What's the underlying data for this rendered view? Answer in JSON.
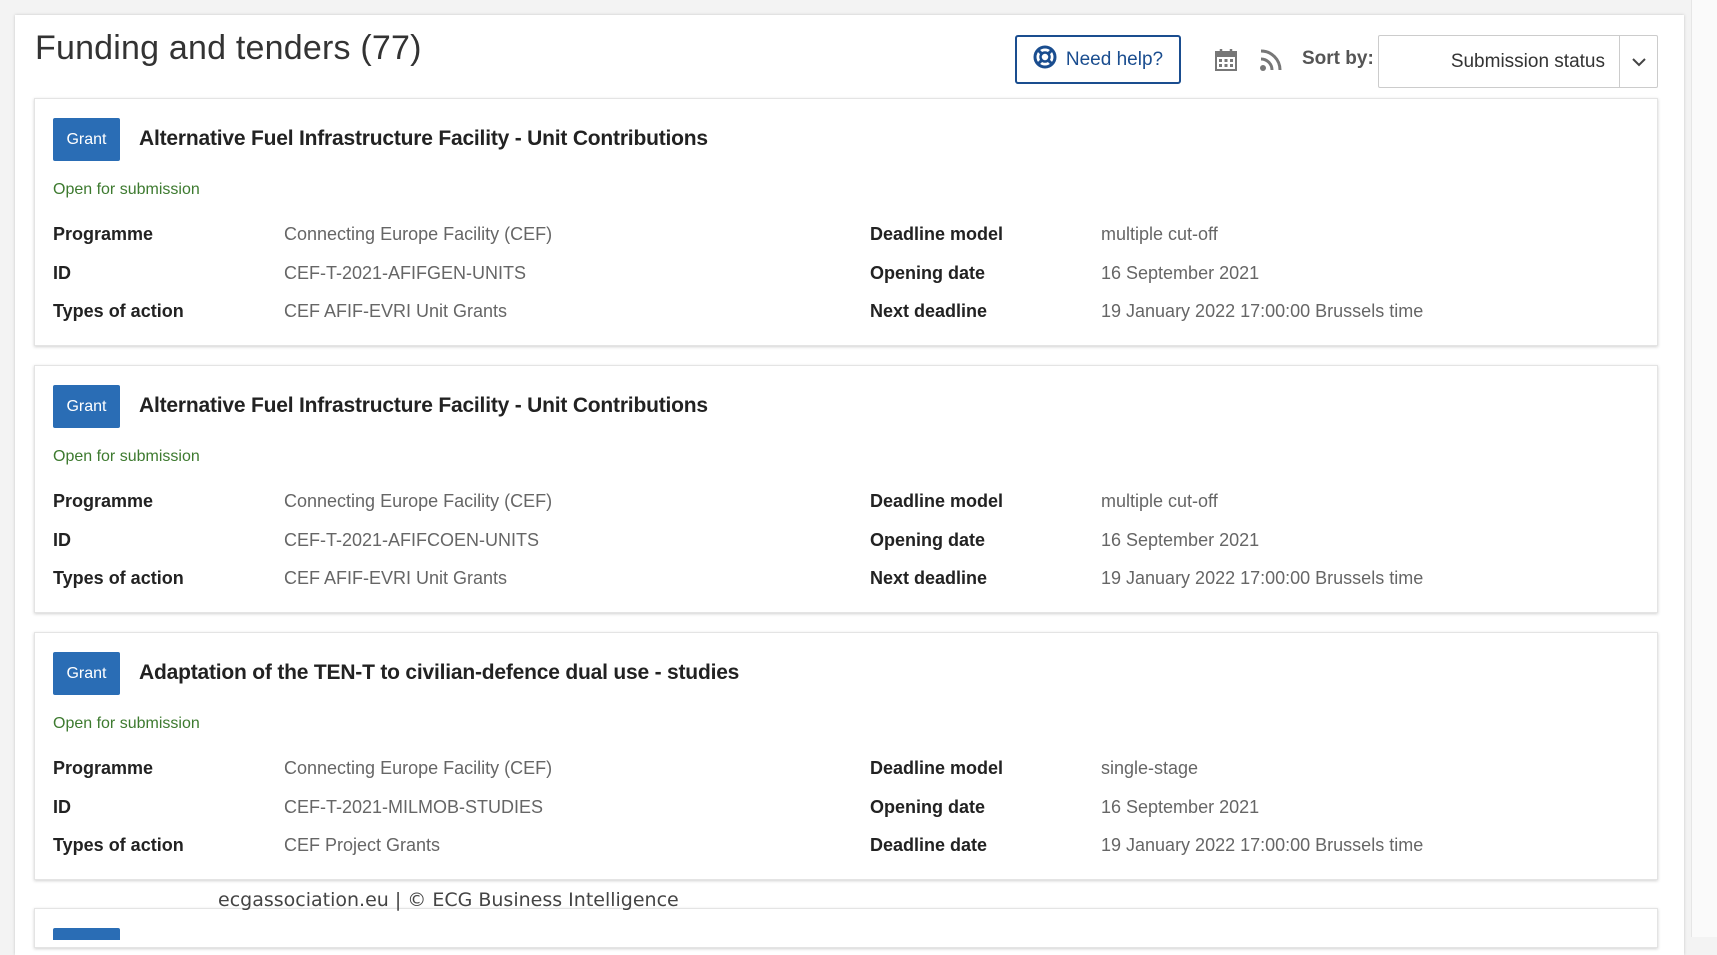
{
  "header": {
    "title": "Funding and tenders (77)",
    "help_label": "Need help?",
    "help_icon": "lifebuoy-icon",
    "calendar_icon": "calendar-icon",
    "rss_icon": "rss-icon",
    "sort_label": "Sort by:",
    "sort_value": "Submission status"
  },
  "labels": {
    "programme": "Programme",
    "id": "ID",
    "types_of_action": "Types of action",
    "deadline_model": "Deadline model",
    "opening_date": "Opening date"
  },
  "results": [
    {
      "badge": "Grant",
      "title": "Alternative Fuel Infrastructure Facility - Unit Contributions",
      "status": "Open for submission",
      "programme": "Connecting Europe Facility (CEF)",
      "id": "CEF-T-2021-AFIFGEN-UNITS",
      "types_of_action": "CEF AFIF-EVRI Unit Grants",
      "deadline_model": "multiple cut-off",
      "opening_date": "16 September 2021",
      "deadline_label": "Next deadline",
      "deadline": "19 January 2022 17:00:00 Brussels time"
    },
    {
      "badge": "Grant",
      "title": "Alternative Fuel Infrastructure Facility - Unit Contributions",
      "status": "Open for submission",
      "programme": "Connecting Europe Facility (CEF)",
      "id": "CEF-T-2021-AFIFCOEN-UNITS",
      "types_of_action": "CEF AFIF-EVRI Unit Grants",
      "deadline_model": "multiple cut-off",
      "opening_date": "16 September 2021",
      "deadline_label": "Next deadline",
      "deadline": "19 January 2022 17:00:00 Brussels time"
    },
    {
      "badge": "Grant",
      "title": "Adaptation of the TEN-T to civilian-defence dual use - studies",
      "status": "Open for submission",
      "programme": "Connecting Europe Facility (CEF)",
      "id": "CEF-T-2021-MILMOB-STUDIES",
      "types_of_action": "CEF Project Grants",
      "deadline_model": "single-stage",
      "opening_date": "16 September 2021",
      "deadline_label": "Deadline date",
      "deadline": "19 January 2022 17:00:00 Brussels time"
    }
  ],
  "footer": {
    "watermark": "ecgassociation.eu  |  © ECG Business Intelligence"
  },
  "colors": {
    "badge": "#2a6db5",
    "status": "#3d7a2f",
    "help_border": "#1a4d8f"
  }
}
